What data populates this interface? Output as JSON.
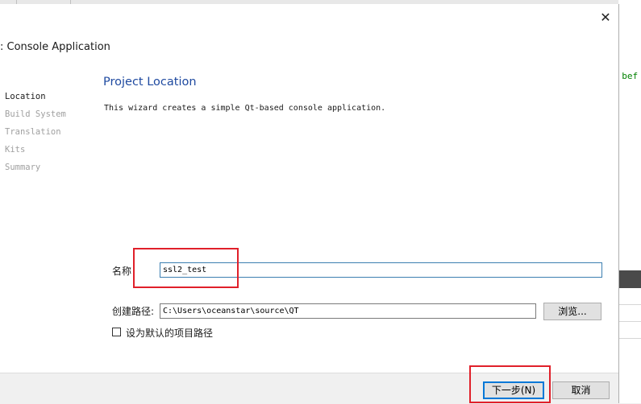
{
  "background": {
    "code_fragment": "l bef"
  },
  "dialog": {
    "title": ": Console Application",
    "close_glyph": "✕",
    "steps": [
      {
        "label": "Location",
        "active": true
      },
      {
        "label": "Build System",
        "active": false
      },
      {
        "label": "Translation",
        "active": false
      },
      {
        "label": "Kits",
        "active": false
      },
      {
        "label": "Summary",
        "active": false
      }
    ],
    "page_title": "Project Location",
    "description": "This wizard creates a simple Qt-based console application.",
    "name_label": "名称",
    "name_value": "ssl2_test",
    "path_label": "创建路径:",
    "path_value": "C:\\Users\\oceanstar\\source\\QT",
    "browse_label": "浏览...",
    "default_path_label": "设为默认的项目路径",
    "default_path_checked": false,
    "next_label": "下一步(N)",
    "cancel_label": "取消"
  },
  "colors": {
    "title_blue": "#1f4aa0",
    "annotation_red": "#e0202a",
    "focus_blue": "#0078d7"
  },
  "icons": {
    "close": "close-icon"
  }
}
